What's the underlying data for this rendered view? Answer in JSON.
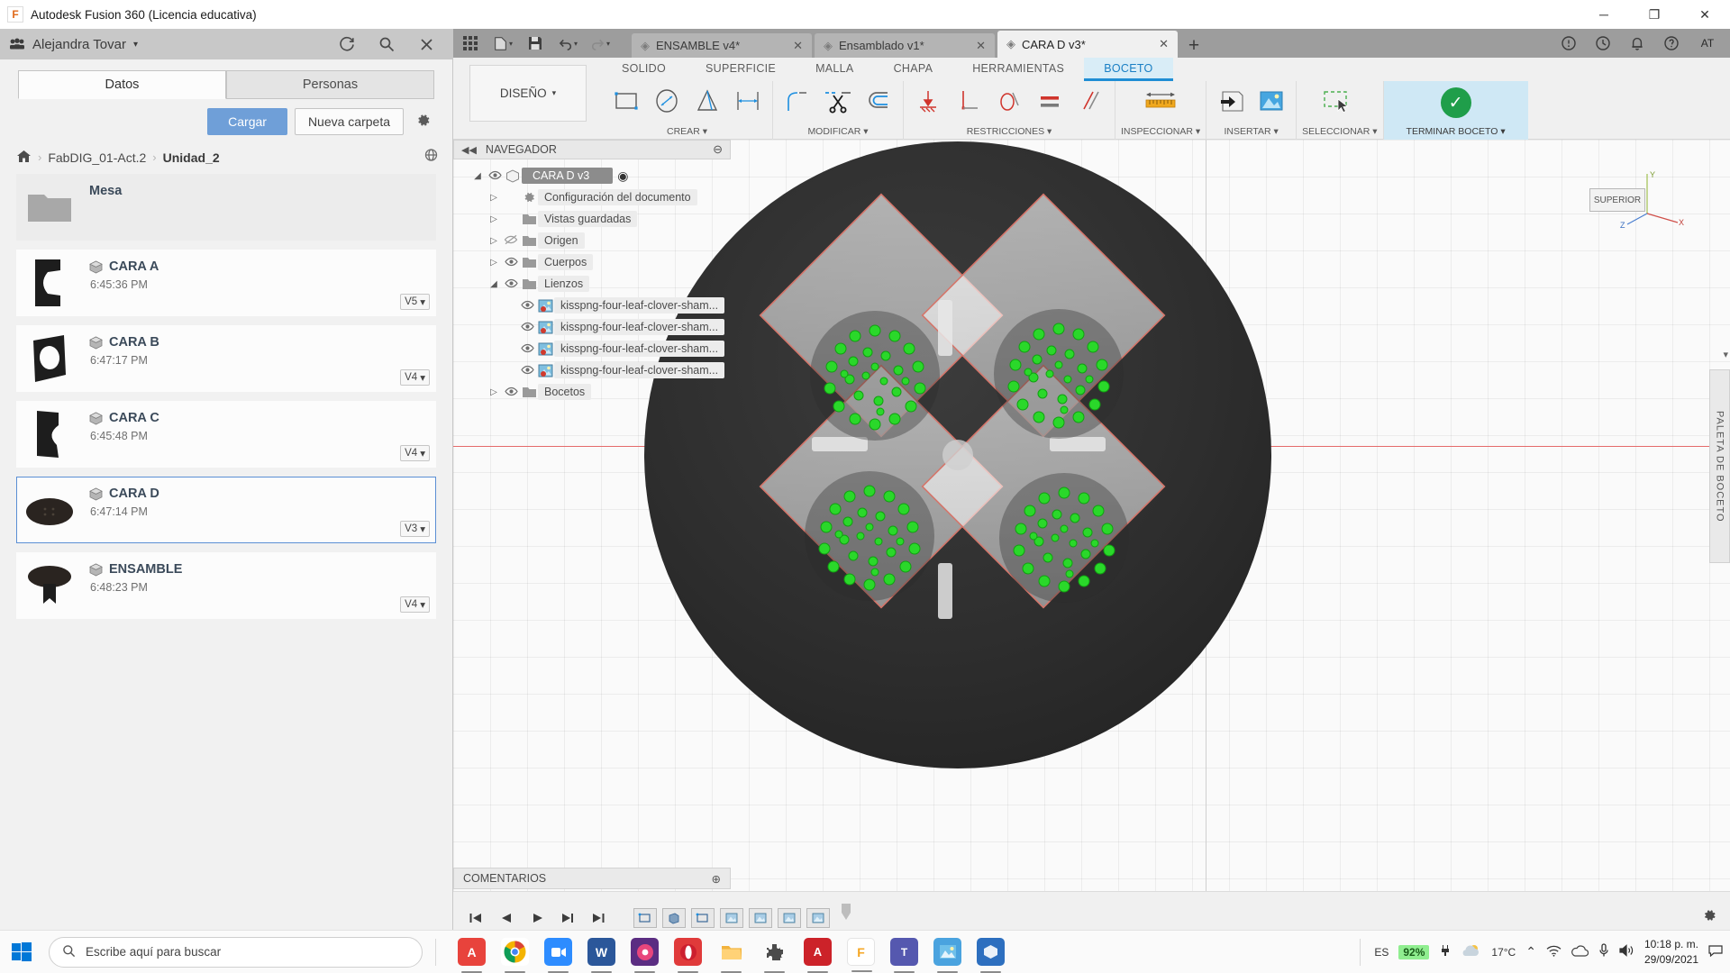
{
  "window": {
    "title": "Autodesk Fusion 360 (Licencia educativa)",
    "app_icon": "fusion-logo-icon",
    "minimize": "─",
    "maximize": "❐",
    "close": "✕"
  },
  "data_panel": {
    "user": "Alejandra Tovar",
    "user_caret": "▾",
    "people_icon": "people-icon",
    "refresh_icon": "refresh-icon",
    "search_icon": "search-icon",
    "close_icon": "close-icon",
    "tabs": [
      {
        "label": "Datos",
        "active": true
      },
      {
        "label": "Personas",
        "active": false
      }
    ],
    "upload_label": "Cargar",
    "new_folder_label": "Nueva carpeta",
    "settings_icon": "gear-icon",
    "breadcrumb": {
      "home_icon": "home-icon",
      "items": [
        "FabDIG_01-Act.2",
        "Unidad_2"
      ],
      "separator": "›",
      "globe_icon": "globe-icon"
    },
    "files": [
      {
        "name": "Mesa",
        "time": "",
        "version": "",
        "type": "folder",
        "selected": false
      },
      {
        "name": "CARA A",
        "time": "6:45:36 PM",
        "version": "V5",
        "type": "design",
        "selected": false
      },
      {
        "name": "CARA B",
        "time": "6:47:17 PM",
        "version": "V4",
        "type": "design",
        "selected": false
      },
      {
        "name": "CARA C",
        "time": "6:45:48 PM",
        "version": "V4",
        "type": "design",
        "selected": false
      },
      {
        "name": "CARA D",
        "time": "6:47:14 PM",
        "version": "V3",
        "type": "design",
        "selected": true
      },
      {
        "name": "ENSAMBLE",
        "time": "6:48:23 PM",
        "version": "V4",
        "type": "design",
        "selected": false
      }
    ],
    "version_caret": "▾"
  },
  "fusion": {
    "appbar": {
      "grid_icon": "apps-grid-icon",
      "new_icon": "new-document-icon",
      "save_icon": "save-icon",
      "undo_icon": "undo-icon",
      "redo_icon": "redo-icon",
      "doc_tabs": [
        {
          "label": "ENSAMBLE v4*",
          "active": false,
          "close": "✕"
        },
        {
          "label": "Ensamblado v1*",
          "active": false,
          "close": "✕"
        },
        {
          "label": "CARA D v3*",
          "active": true,
          "close": "✕"
        }
      ],
      "add_tab": "+",
      "right_icons": [
        "help-circle-icon",
        "clock-icon",
        "bell-icon",
        "question-icon"
      ],
      "avatar_initials": "AT"
    },
    "ribbon": {
      "workspace_label": "DISEÑO",
      "workspace_caret": "▾",
      "tabs": [
        {
          "label": "SOLIDO",
          "active": false
        },
        {
          "label": "SUPERFICIE",
          "active": false
        },
        {
          "label": "MALLA",
          "active": false
        },
        {
          "label": "CHAPA",
          "active": false
        },
        {
          "label": "HERRAMIENTAS",
          "active": false
        },
        {
          "label": "BOCETO",
          "active": true
        }
      ],
      "panels": [
        {
          "label": "CREAR ▾",
          "icons": [
            "rectangle-icon",
            "circle-diameter-icon",
            "line-icon",
            "dimension-icon"
          ]
        },
        {
          "label": "MODIFICAR ▾",
          "icons": [
            "fillet-icon",
            "trim-icon",
            "offset-icon"
          ]
        },
        {
          "label": "RESTRICCIONES ▾",
          "icons": [
            "horizontal-vertical-icon",
            "perpendicular-icon",
            "tangent-icon",
            "equal-icon",
            "parallel-icon"
          ]
        },
        {
          "label": "INSPECCIONAR ▾",
          "icons": [
            "measure-ruler-icon"
          ]
        },
        {
          "label": "INSERTAR ▾",
          "icons": [
            "insert-derive-icon",
            "insert-canvas-icon"
          ]
        },
        {
          "label": "SELECCIONAR ▾",
          "icons": [
            "select-window-icon"
          ]
        }
      ],
      "finish_label": "TERMINAR BOCETO ▾",
      "finish_icon": "check-circle-icon"
    },
    "navigator": {
      "title": "NAVEGADOR",
      "collapse_icon": "◀◀",
      "menu_icon": "⊖",
      "tree": [
        {
          "label": "CARA D v3",
          "level": 0,
          "expander": "◢",
          "eye": "◉",
          "icon": "component-icon",
          "root": true,
          "radio": "◉"
        },
        {
          "label": "Configuración del documento",
          "level": 1,
          "expander": "▷",
          "eye": "",
          "icon": "gear-icon"
        },
        {
          "label": "Vistas guardadas",
          "level": 1,
          "expander": "▷",
          "eye": "",
          "icon": "folder-icon"
        },
        {
          "label": "Origen",
          "level": 1,
          "expander": "▷",
          "eye": "hidden",
          "icon": "folder-icon"
        },
        {
          "label": "Cuerpos",
          "level": 1,
          "expander": "▷",
          "eye": "visible",
          "icon": "folder-icon"
        },
        {
          "label": "Lienzos",
          "level": 1,
          "expander": "◢",
          "eye": "visible",
          "icon": "folder-icon"
        },
        {
          "label": "kisspng-four-leaf-clover-sham...",
          "level": 2,
          "expander": "",
          "eye": "visible",
          "icon": "canvas-image-icon"
        },
        {
          "label": "kisspng-four-leaf-clover-sham...",
          "level": 2,
          "expander": "",
          "eye": "visible",
          "icon": "canvas-image-icon"
        },
        {
          "label": "kisspng-four-leaf-clover-sham...",
          "level": 2,
          "expander": "",
          "eye": "visible",
          "icon": "canvas-image-icon"
        },
        {
          "label": "kisspng-four-leaf-clover-sham...",
          "level": 2,
          "expander": "",
          "eye": "visible",
          "icon": "canvas-image-icon"
        },
        {
          "label": "Bocetos",
          "level": 1,
          "expander": "▷",
          "eye": "visible",
          "icon": "folder-icon"
        }
      ]
    },
    "comments": {
      "label": "COMENTARIOS",
      "menu_icon": "⊕"
    },
    "sketch_palette": {
      "label": "PALETA DE BOCETO",
      "arrow": "▾"
    },
    "viewcube": {
      "face_label": "SUPERIOR",
      "axis_x": "X",
      "axis_y": "Y",
      "axis_z": "Z"
    },
    "viewbar": {
      "buttons": [
        {
          "icon": "orbit-icon",
          "name": "orbit-tool",
          "active": false,
          "caret": "▾"
        },
        {
          "icon": "camera-icon",
          "name": "look-at-tool",
          "active": false,
          "caret": ""
        },
        {
          "icon": "pan-hand-icon",
          "name": "pan-tool",
          "active": true,
          "caret": ""
        },
        {
          "icon": "zoom-icon",
          "name": "zoom-tool",
          "active": false,
          "caret": "▾"
        },
        {
          "icon": "zoom-fit-icon",
          "name": "fit-tool",
          "active": false,
          "caret": ""
        },
        {
          "icon": "display-settings-icon",
          "name": "display-settings",
          "active": false,
          "caret": "▾"
        },
        {
          "icon": "grid-snap-icon",
          "name": "grid-snaps",
          "active": false,
          "caret": "▾"
        },
        {
          "icon": "viewports-icon",
          "name": "viewports",
          "active": false,
          "caret": "▾"
        }
      ],
      "warning_icon": "warning-triangle-icon"
    },
    "timeline": {
      "buttons": [
        "skip-start-icon",
        "step-back-icon",
        "play-icon",
        "step-forward-icon",
        "skip-end-icon"
      ],
      "features": [
        "sketch-feature-icon",
        "extrude-feature-icon",
        "sketch-feature-icon",
        "canvas-feature-icon",
        "canvas-feature-icon",
        "canvas-feature-icon",
        "canvas-feature-icon"
      ],
      "settings_icon": "gear-icon"
    }
  },
  "taskbar": {
    "start_icon": "windows-start-icon",
    "search_placeholder": "Escribe aquí para buscar",
    "search_icon": "search-icon",
    "apps": [
      {
        "name": "acrobat-reader-app",
        "glyph": "A",
        "color": "#e8433c",
        "open": true
      },
      {
        "name": "google-chrome-app",
        "glyph": "",
        "color": "#ffffff",
        "open": true
      },
      {
        "name": "zoom-app",
        "glyph": "▶",
        "color": "#2d8cff",
        "open": true
      },
      {
        "name": "word-app",
        "glyph": "W",
        "color": "#2b579a",
        "open": true
      },
      {
        "name": "media-player-app",
        "glyph": "◉",
        "color": "#6b2f8a",
        "open": true
      },
      {
        "name": "opera-app",
        "glyph": "O",
        "color": "#e03a3a",
        "open": true
      },
      {
        "name": "file-explorer-app",
        "glyph": "▭",
        "color": "#f2b33d",
        "open": true
      },
      {
        "name": "extension-app",
        "glyph": "✦",
        "color": "#4b4b4b",
        "open": true
      },
      {
        "name": "adobe-acrobat-app",
        "glyph": "▲",
        "color": "#cc2229",
        "open": true
      },
      {
        "name": "fusion-360-app",
        "glyph": "F",
        "color": "#f5a623",
        "open": true
      },
      {
        "name": "teams-app",
        "glyph": "T",
        "color": "#5558af",
        "open": true
      },
      {
        "name": "photos-app",
        "glyph": "◰",
        "color": "#4aa3df",
        "open": true
      },
      {
        "name": "fusion-team-app",
        "glyph": "◆",
        "color": "#2d6fbf",
        "open": true
      }
    ],
    "tray": {
      "language": "ES",
      "battery": "92%",
      "weather_temp": "17°C",
      "weather_icon": "cloud-icon",
      "chevron_icon": "⌃",
      "network_icon": "wifi-icon",
      "cloud_icon": "onedrive-icon",
      "mic_icon": "mic-icon",
      "volume_icon": "speaker-icon",
      "time": "10:18 p. m.",
      "date": "29/09/2021",
      "notifications_icon": "notification-icon"
    }
  }
}
